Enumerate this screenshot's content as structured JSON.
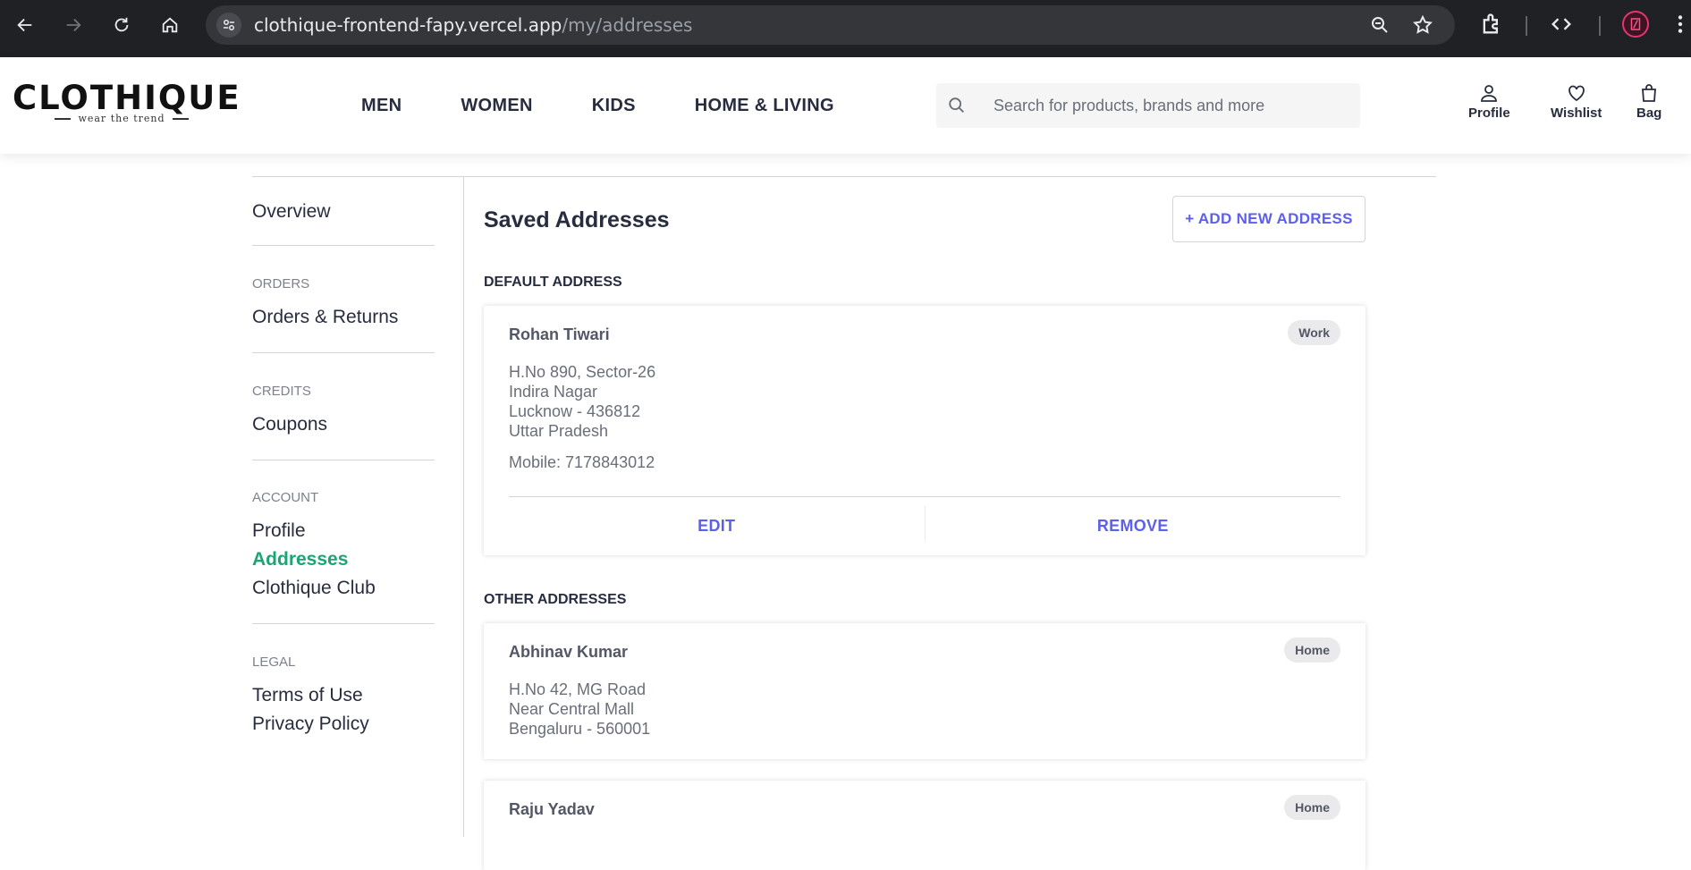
{
  "browser": {
    "url_host": "clothique-frontend-fapy.vercel.app",
    "url_path": "/my/addresses"
  },
  "header": {
    "logo_text": "CLOTHIQUE",
    "logo_tagline": "wear the trend",
    "nav": [
      "MEN",
      "WOMEN",
      "KIDS",
      "HOME & LIVING"
    ],
    "search_placeholder": "Search for products, brands and more",
    "actions": {
      "profile": "Profile",
      "wishlist": "Wishlist",
      "bag": "Bag"
    }
  },
  "sidebar": {
    "overview": "Overview",
    "sections": [
      {
        "title": "ORDERS",
        "links": [
          "Orders & Returns"
        ]
      },
      {
        "title": "CREDITS",
        "links": [
          "Coupons"
        ]
      },
      {
        "title": "ACCOUNT",
        "links": [
          "Profile",
          "Addresses",
          "Clothique Club"
        ]
      },
      {
        "title": "LEGAL",
        "links": [
          "Terms of Use",
          "Privacy Policy"
        ]
      }
    ],
    "active_link": "Addresses"
  },
  "main": {
    "title": "Saved Addresses",
    "add_button": "+ ADD NEW ADDRESS",
    "default_title": "DEFAULT ADDRESS",
    "other_title": "OTHER ADDRESSES",
    "default_address": {
      "name": "Rohan Tiwari",
      "type": "Work",
      "line1": "H.No 890, Sector-26",
      "line2": "Indira Nagar",
      "line3": "Lucknow - 436812",
      "line4": "Uttar Pradesh",
      "mobile": "Mobile: 7178843012",
      "edit": "EDIT",
      "remove": "REMOVE"
    },
    "other_addresses": [
      {
        "name": "Abhinav Kumar",
        "type": "Home",
        "line1": "H.No 42, MG Road",
        "line2": "Near Central Mall",
        "line3": "Bengaluru - 560001"
      },
      {
        "name": "Raju Yadav",
        "type": "Home"
      }
    ]
  },
  "colors": {
    "accent": "#5d5fef",
    "active": "#1aa672",
    "text": "#282c3f",
    "chrome_bg": "#202124"
  }
}
